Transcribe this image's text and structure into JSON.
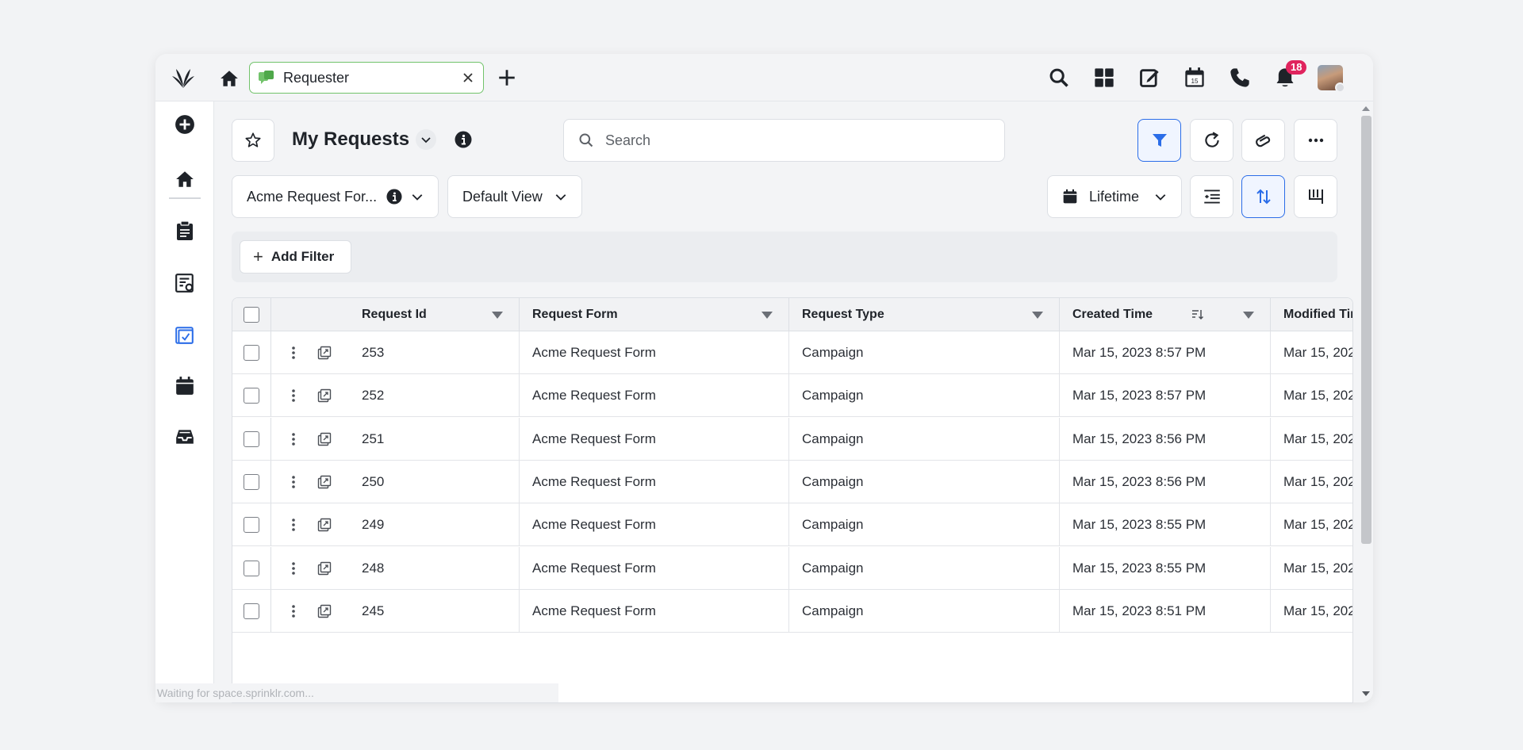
{
  "tab": {
    "label": "Requester"
  },
  "notifications": {
    "count": "18"
  },
  "header": {
    "title": "My Requests"
  },
  "search": {
    "placeholder": "Search"
  },
  "filters": {
    "form_dropdown": "Acme Request For...",
    "view_dropdown": "Default View",
    "date_range": "Lifetime",
    "add_filter_label": "Add Filter"
  },
  "table": {
    "columns": [
      "Request Id",
      "Request Form",
      "Request Type",
      "Created Time",
      "Modified Tin"
    ],
    "rows": [
      {
        "id": "253",
        "form": "Acme Request Form",
        "type": "Campaign",
        "created": "Mar 15, 2023 8:57 PM",
        "modified": "Mar 15, 202"
      },
      {
        "id": "252",
        "form": "Acme Request Form",
        "type": "Campaign",
        "created": "Mar 15, 2023 8:57 PM",
        "modified": "Mar 15, 202"
      },
      {
        "id": "251",
        "form": "Acme Request Form",
        "type": "Campaign",
        "created": "Mar 15, 2023 8:56 PM",
        "modified": "Mar 15, 202"
      },
      {
        "id": "250",
        "form": "Acme Request Form",
        "type": "Campaign",
        "created": "Mar 15, 2023 8:56 PM",
        "modified": "Mar 15, 202"
      },
      {
        "id": "249",
        "form": "Acme Request Form",
        "type": "Campaign",
        "created": "Mar 15, 2023 8:55 PM",
        "modified": "Mar 15, 202"
      },
      {
        "id": "248",
        "form": "Acme Request Form",
        "type": "Campaign",
        "created": "Mar 15, 2023 8:55 PM",
        "modified": "Mar 15, 202"
      },
      {
        "id": "245",
        "form": "Acme Request Form",
        "type": "Campaign",
        "created": "Mar 15, 2023 8:51 PM",
        "modified": "Mar 15, 202"
      }
    ]
  },
  "status_bar": {
    "text": "Waiting for space.sprinklr.com..."
  },
  "colors": {
    "accent": "#2b6de8",
    "tab_border": "#72c36b",
    "badge": "#e0245e"
  }
}
